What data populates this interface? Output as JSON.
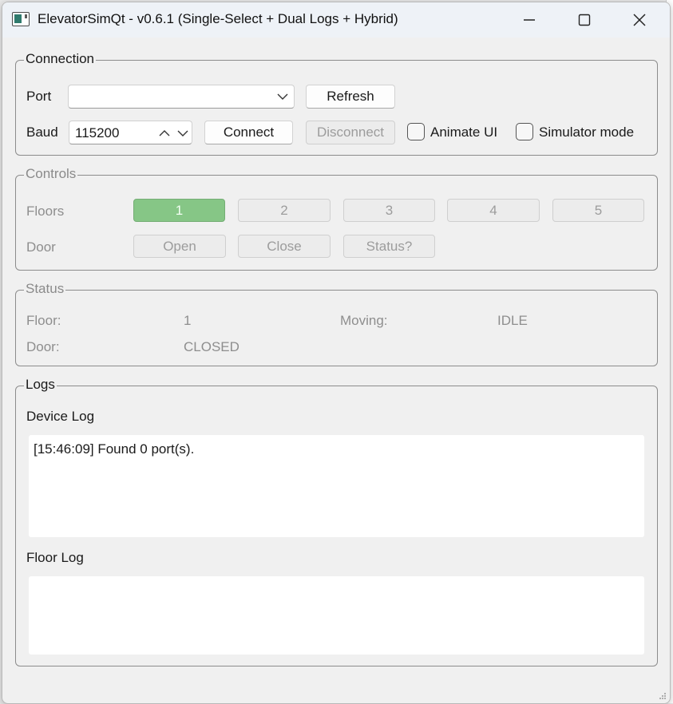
{
  "window": {
    "title": "ElevatorSimQt - v0.6.1 (Single-Select + Dual Logs + Hybrid)"
  },
  "connection": {
    "title": "Connection",
    "port_label": "Port",
    "port_value": "",
    "refresh_label": "Refresh",
    "baud_label": "Baud",
    "baud_value": "115200",
    "connect_label": "Connect",
    "disconnect_label": "Disconnect",
    "animate_label": "Animate UI",
    "animate_checked": false,
    "simulator_label": "Simulator mode",
    "simulator_checked": false
  },
  "controls": {
    "title": "Controls",
    "floors_label": "Floors",
    "floors": [
      "1",
      "2",
      "3",
      "4",
      "5"
    ],
    "selected_floor": "1",
    "door_label": "Door",
    "door_buttons": [
      "Open",
      "Close",
      "Status?"
    ]
  },
  "status": {
    "title": "Status",
    "floor_label": "Floor:",
    "floor_value": "1",
    "moving_label": "Moving:",
    "moving_value": "IDLE",
    "door_label": "Door:",
    "door_value": "CLOSED"
  },
  "logs": {
    "title": "Logs",
    "device_log_label": "Device Log",
    "device_log_lines": [
      "[15:46:09] Found 0 port(s)."
    ],
    "floor_log_label": "Floor Log",
    "floor_log_lines": []
  },
  "icons": {
    "app": "app-window-icon",
    "minimize": "minimize-icon",
    "maximize": "maximize-icon",
    "close": "close-icon",
    "dropdown": "chevron-down-icon",
    "spin_up": "chevron-up-icon",
    "spin_down": "chevron-down-icon",
    "grip": "resize-grip-icon"
  },
  "colors": {
    "selected_floor": "#86c686",
    "titlebar": "#eef2f7",
    "window_bg": "#f0f0f0"
  }
}
